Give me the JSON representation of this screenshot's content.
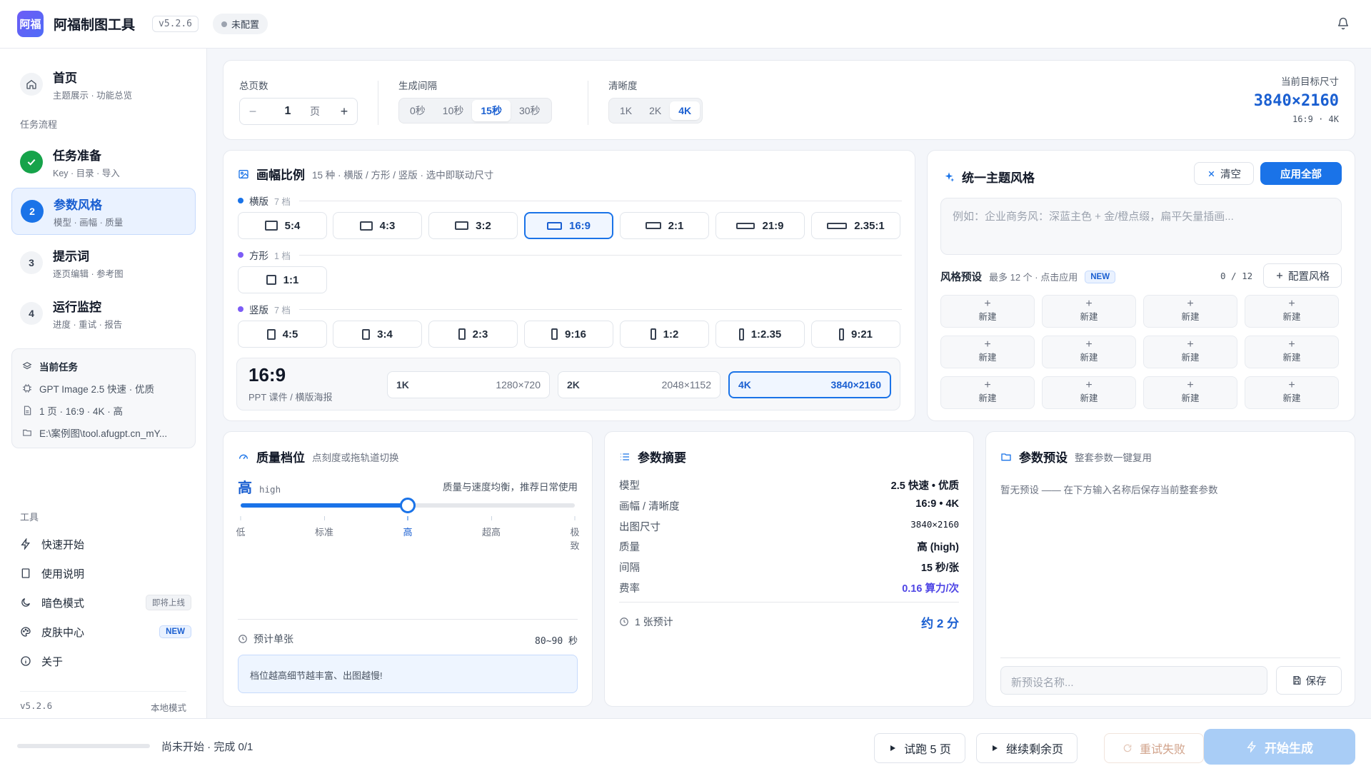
{
  "app": {
    "logo_text": "阿福",
    "title": "阿福制图工具",
    "version_badge": "v5.2.6",
    "config_status": "未配置"
  },
  "sidebar": {
    "home": {
      "title": "首页",
      "subtitle": "主题展示 · 功能总览"
    },
    "section_label": "任务流程",
    "steps": [
      {
        "num": "✓",
        "title": "任务准备",
        "subtitle": "Key · 目录 · 导入",
        "state": "done"
      },
      {
        "num": "2",
        "title": "参数风格",
        "subtitle": "模型 · 画幅 · 质量",
        "state": "active"
      },
      {
        "num": "3",
        "title": "提示词",
        "subtitle": "逐页编辑 · 参考图",
        "state": "todo"
      },
      {
        "num": "4",
        "title": "运行监控",
        "subtitle": "进度 · 重试 · 报告",
        "state": "todo"
      }
    ],
    "current_task": {
      "title": "当前任务",
      "model": "GPT Image 2.5 快速 · 优质",
      "spec": "1 页 · 16:9 · 4K · 高",
      "path": "E:\\案例图\\tool.afugpt.cn_mY..."
    },
    "tools_label": "工具",
    "tools": [
      {
        "label": "快速开始",
        "icon": "bolt-icon"
      },
      {
        "label": "使用说明",
        "icon": "book-icon"
      },
      {
        "label": "暗色模式",
        "icon": "moon-icon",
        "tag": "即将上线"
      },
      {
        "label": "皮肤中心",
        "icon": "palette-icon",
        "tag": "NEW"
      },
      {
        "label": "关于",
        "icon": "info-icon"
      }
    ],
    "footer": {
      "version": "v5.2.6",
      "mode": "本地模式"
    }
  },
  "top_settings": {
    "pages": {
      "label": "总页数",
      "value": "1",
      "unit": "页",
      "minus": "−",
      "plus": "+"
    },
    "interval": {
      "label": "生成间隔",
      "options": [
        "0秒",
        "10秒",
        "15秒",
        "30秒"
      ],
      "selected": "15秒"
    },
    "clarity": {
      "label": "清晰度",
      "options": [
        "1K",
        "2K",
        "4K"
      ],
      "selected": "4K"
    },
    "target": {
      "label": "当前目标尺寸",
      "size": "3840×2160",
      "meta": "16:9 · 4K"
    }
  },
  "aspect": {
    "title": "画幅比例",
    "subtitle": "15 种 · 横版 / 方形 / 竖版 · 选中即联动尺寸",
    "groups": [
      {
        "name": "横版",
        "count": "7 档",
        "color": "#1a73e8",
        "items": [
          "5:4",
          "4:3",
          "3:2",
          "16:9",
          "2:1",
          "21:9",
          "2.35:1"
        ]
      },
      {
        "name": "方形",
        "count": "1 档",
        "color": "#7c5cf6",
        "items": [
          "1:1"
        ]
      },
      {
        "name": "竖版",
        "count": "7 档",
        "color": "#7c5cf6",
        "items": [
          "4:5",
          "3:4",
          "2:3",
          "9:16",
          "1:2",
          "1:2.35",
          "9:21"
        ]
      }
    ],
    "selected": "16:9",
    "summary": {
      "ratio": "16:9",
      "use": "PPT 课件 / 横版海报"
    },
    "resolutions": [
      {
        "key": "1K",
        "dim": "1280×720"
      },
      {
        "key": "2K",
        "dim": "2048×1152"
      },
      {
        "key": "4K",
        "dim": "3840×2160"
      }
    ],
    "selected_resolution": "4K"
  },
  "theme": {
    "title": "统一主题风格",
    "clear_label": "清空",
    "apply_label": "应用全部",
    "placeholder": "例如：企业商务风：深蓝主色 + 金/橙点缀，扁平矢量插画...",
    "presets_title": "风格预设",
    "presets_hint": "最多 12 个 · 点击应用",
    "new_tag": "NEW",
    "count": "0 / 12",
    "config_label": "配置风格",
    "preset_items": [
      "新建",
      "新建",
      "新建",
      "新建",
      "新建",
      "新建",
      "新建",
      "新建",
      "新建",
      "新建",
      "新建",
      "新建"
    ],
    "preset_plus": "+"
  },
  "quality": {
    "title": "质量档位",
    "subtitle": "点刻度或拖轨道切换",
    "current": "高",
    "current_code": "high",
    "desc": "质量与速度均衡，推荐日常使用",
    "levels": [
      "低",
      "标准",
      "高",
      "超高",
      "极致"
    ],
    "level_index": 2,
    "estimate_label": "预计单张",
    "estimate_value": "80~90 秒",
    "note": "档位越高细节越丰富、出图越慢!"
  },
  "params": {
    "title": "参数摘要",
    "rows": [
      {
        "k": "模型",
        "v": "2.5 快速 • 优质"
      },
      {
        "k": "画幅 / 清晰度",
        "v": "16:9 • 4K"
      },
      {
        "k": "出图尺寸",
        "v": "3840×2160"
      },
      {
        "k": "质量",
        "v": "高 (high)"
      },
      {
        "k": "间隔",
        "v": "15 秒/张"
      },
      {
        "k": "费率",
        "v": "0.16 算力/次"
      }
    ],
    "eta_label": "1 张预计",
    "eta_value": "约 2 分"
  },
  "param_presets": {
    "title": "参数预设",
    "subtitle": "整套参数一键复用",
    "empty": "暂无预设 —— 在下方输入名称后保存当前整套参数",
    "name_placeholder": "新预设名称...",
    "save_label": "保存"
  },
  "bottom": {
    "status": "尚未开始 · 完成 0/1",
    "progress": 0,
    "trial_label": "试跑 5 页",
    "continue_label": "继续剩余页",
    "retry_label": "重试失败",
    "start_label": "开始生成"
  },
  "colors": {
    "accent": "#1a73e8",
    "success": "#16a34a",
    "purple": "#7c5cf6"
  }
}
